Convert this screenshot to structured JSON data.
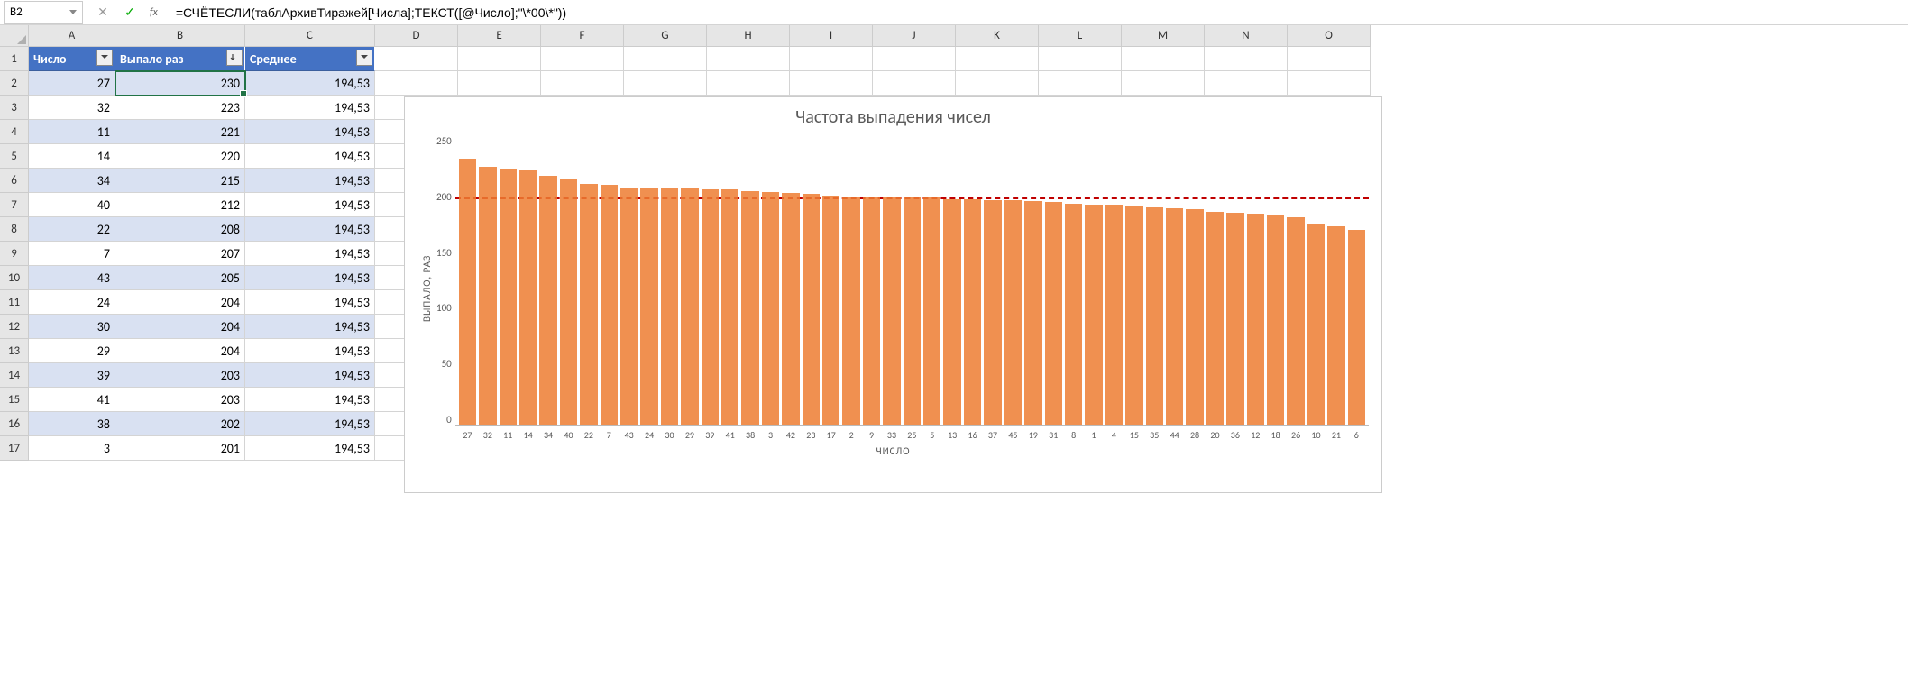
{
  "name_box": "B2",
  "formula": "=СЧЁТЕСЛИ(таблАрхивТиражей[Числа];ТЕКСТ([@Число];\"\\*00\\*\"))",
  "columns": [
    "A",
    "B",
    "C",
    "D",
    "E",
    "F",
    "G",
    "H",
    "I",
    "J",
    "K",
    "L",
    "M",
    "N",
    "O"
  ],
  "col_widths": [
    "wA",
    "wB",
    "wC",
    "wR",
    "wR",
    "wR",
    "wR",
    "wR",
    "wR",
    "wR",
    "wR",
    "wR",
    "wR",
    "wR",
    "wR"
  ],
  "rows": [
    1,
    2,
    3,
    4,
    5,
    6,
    7,
    8,
    9,
    10,
    11,
    12,
    13,
    14,
    15,
    16,
    17
  ],
  "table": {
    "headers": [
      "Число",
      "Выпало раз",
      "Среднее"
    ],
    "data": [
      [
        "27",
        "230",
        "194,53"
      ],
      [
        "32",
        "223",
        "194,53"
      ],
      [
        "11",
        "221",
        "194,53"
      ],
      [
        "14",
        "220",
        "194,53"
      ],
      [
        "34",
        "215",
        "194,53"
      ],
      [
        "40",
        "212",
        "194,53"
      ],
      [
        "22",
        "208",
        "194,53"
      ],
      [
        "7",
        "207",
        "194,53"
      ],
      [
        "43",
        "205",
        "194,53"
      ],
      [
        "24",
        "204",
        "194,53"
      ],
      [
        "30",
        "204",
        "194,53"
      ],
      [
        "29",
        "204",
        "194,53"
      ],
      [
        "39",
        "203",
        "194,53"
      ],
      [
        "41",
        "203",
        "194,53"
      ],
      [
        "38",
        "202",
        "194,53"
      ],
      [
        "3",
        "201",
        "194,53"
      ]
    ]
  },
  "chart_data": {
    "type": "bar",
    "title": "Частота выпадения чисел",
    "ylabel": "ВЫПАЛО, РАЗ",
    "xlabel": "ЧИСЛО",
    "ylim": [
      0,
      250
    ],
    "yticks": [
      0,
      50,
      100,
      150,
      200,
      250
    ],
    "average": 194.53,
    "categories": [
      "27",
      "32",
      "11",
      "14",
      "34",
      "40",
      "22",
      "7",
      "43",
      "24",
      "30",
      "29",
      "39",
      "41",
      "38",
      "3",
      "42",
      "23",
      "17",
      "2",
      "9",
      "33",
      "25",
      "5",
      "13",
      "16",
      "37",
      "45",
      "19",
      "31",
      "8",
      "1",
      "4",
      "15",
      "35",
      "44",
      "28",
      "20",
      "36",
      "12",
      "18",
      "26",
      "10",
      "21",
      "6"
    ],
    "values": [
      230,
      223,
      221,
      220,
      215,
      212,
      208,
      207,
      205,
      204,
      204,
      204,
      203,
      203,
      202,
      201,
      200,
      199,
      198,
      197,
      197,
      196,
      196,
      196,
      195,
      195,
      194,
      194,
      193,
      192,
      191,
      190,
      190,
      189,
      188,
      187,
      186,
      184,
      183,
      182,
      181,
      179,
      174,
      171,
      168
    ]
  }
}
